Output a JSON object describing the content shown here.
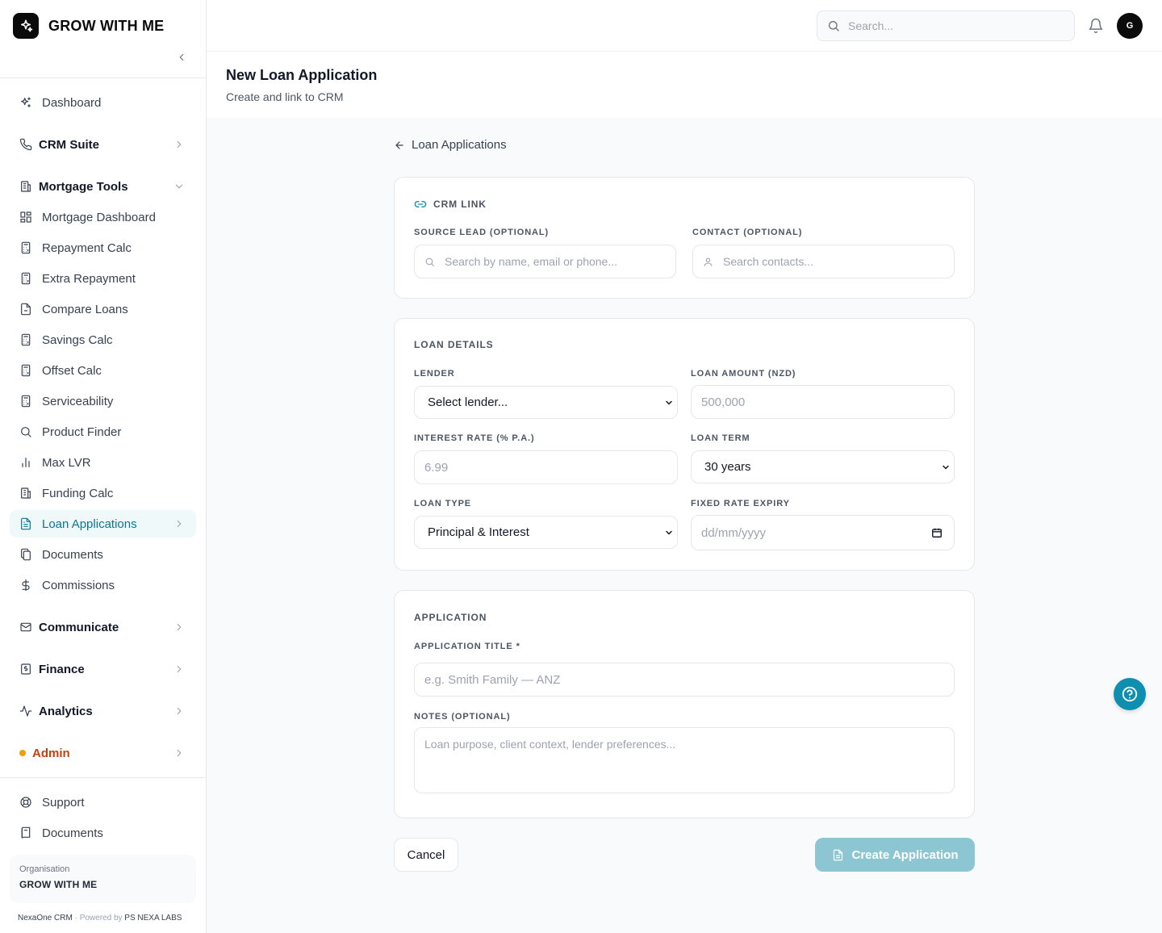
{
  "brand": {
    "name": "GROW WITH ME"
  },
  "search": {
    "placeholder": "Search..."
  },
  "user": {
    "initial": "G"
  },
  "sidebar": {
    "top": [
      {
        "label": "Dashboard",
        "icon": "sparkles-icon"
      }
    ],
    "groups": [
      {
        "label": "CRM Suite",
        "icon": "phone-icon"
      },
      {
        "label": "Mortgage Tools",
        "icon": "building-icon"
      }
    ],
    "mortgage_items": [
      {
        "label": "Mortgage Dashboard",
        "icon": "grid-icon"
      },
      {
        "label": "Repayment Calc",
        "icon": "calculator-icon"
      },
      {
        "label": "Extra Repayment",
        "icon": "calculator-icon"
      },
      {
        "label": "Compare Loans",
        "icon": "file-icon"
      },
      {
        "label": "Savings Calc",
        "icon": "calculator-icon"
      },
      {
        "label": "Offset Calc",
        "icon": "calculator-icon"
      },
      {
        "label": "Serviceability",
        "icon": "calculator-icon"
      },
      {
        "label": "Product Finder",
        "icon": "search-icon"
      },
      {
        "label": "Max LVR",
        "icon": "bar-chart-icon"
      },
      {
        "label": "Funding Calc",
        "icon": "building-icon"
      },
      {
        "label": "Loan Applications",
        "icon": "file-text-icon",
        "active": true
      },
      {
        "label": "Documents",
        "icon": "copy-icon"
      },
      {
        "label": "Commissions",
        "icon": "dollar-icon"
      }
    ],
    "lower_groups": [
      {
        "label": "Communicate",
        "icon": "mail-icon"
      },
      {
        "label": "Finance",
        "icon": "receipt-icon"
      },
      {
        "label": "Analytics",
        "icon": "activity-icon"
      },
      {
        "label": "Admin",
        "icon": "dot-icon"
      }
    ],
    "footer_items": [
      {
        "label": "Support",
        "icon": "lifebuoy-icon"
      },
      {
        "label": "Documents",
        "icon": "book-icon"
      }
    ],
    "org": {
      "label": "Organisation",
      "name": "GROW WITH ME"
    },
    "powered": {
      "product": "NexaOne CRM",
      "sep": " · ",
      "by": "Powered by ",
      "company": "PS NEXA LABS"
    }
  },
  "page": {
    "title": "New Loan Application",
    "subtitle": "Create and link to CRM",
    "back_label": "Loan Applications"
  },
  "crm_link": {
    "title": "CRM LINK",
    "source_lead_label": "SOURCE LEAD (OPTIONAL)",
    "source_lead_placeholder": "Search by name, email or phone...",
    "contact_label": "CONTACT (OPTIONAL)",
    "contact_placeholder": "Search contacts..."
  },
  "loan_details": {
    "title": "LOAN DETAILS",
    "lender_label": "LENDER",
    "lender_value": "Select lender...",
    "amount_label": "LOAN AMOUNT (NZD)",
    "amount_placeholder": "500,000",
    "rate_label": "INTEREST RATE (% P.A.)",
    "rate_placeholder": "6.99",
    "term_label": "LOAN TERM",
    "term_value": "30 years",
    "type_label": "LOAN TYPE",
    "type_value": "Principal & Interest",
    "expiry_label": "FIXED RATE EXPIRY",
    "expiry_placeholder": "dd/mm/yyyy"
  },
  "application": {
    "title": "APPLICATION",
    "app_title_label": "APPLICATION TITLE *",
    "app_title_placeholder": "e.g. Smith Family — ANZ",
    "notes_label": "NOTES (OPTIONAL)",
    "notes_placeholder": "Loan purpose, client context, lender preferences..."
  },
  "actions": {
    "cancel": "Cancel",
    "create": "Create Application"
  },
  "colors": {
    "accent": "#0e7490",
    "create_button": "#8cc6d3",
    "help_fab": "#0e8fb0",
    "admin": "#c2410c"
  }
}
